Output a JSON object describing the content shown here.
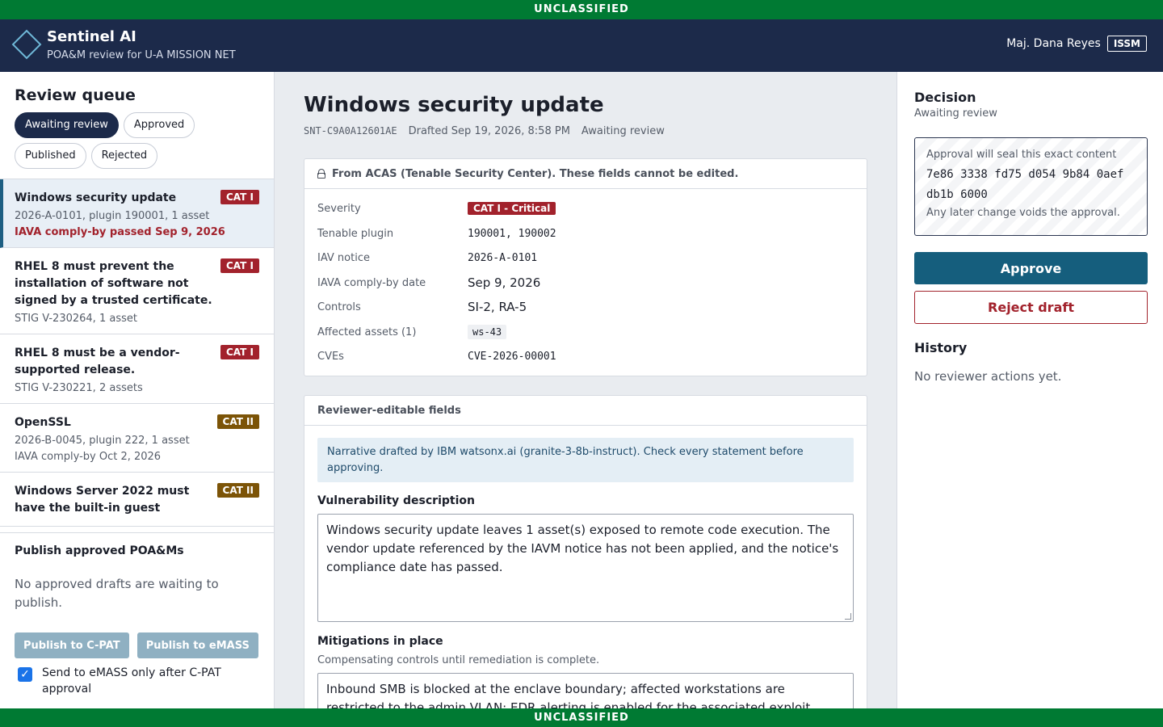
{
  "banner": {
    "top": "UNCLASSIFIED",
    "bottom": "UNCLASSIFIED"
  },
  "app": {
    "name": "Sentinel AI",
    "subtitle": "POA&M review for U-A MISSION NET",
    "logo_icon": "diamond-logo-icon"
  },
  "user": {
    "name": "Maj. Dana Reyes",
    "role": "ISSM"
  },
  "sidebar": {
    "title": "Review queue",
    "filters": [
      {
        "label": "Awaiting review",
        "active": true
      },
      {
        "label": "Approved",
        "active": false
      },
      {
        "label": "Published",
        "active": false
      },
      {
        "label": "Rejected",
        "active": false
      }
    ],
    "items": [
      {
        "title": "Windows security update",
        "meta": "2026-A-0101, plugin 190001, 1 asset",
        "due": "IAVA comply-by passed Sep 9, 2026",
        "overdue": true,
        "cat": "CAT I",
        "selected": true
      },
      {
        "title": "RHEL 8 must prevent the installation of software not signed by a trusted certificate.",
        "meta": "STIG V-230264, 1 asset",
        "due": "",
        "cat": "CAT I"
      },
      {
        "title": "RHEL 8 must be a vendor-supported release.",
        "meta": "STIG V-230221, 2 assets",
        "due": "",
        "cat": "CAT I"
      },
      {
        "title": "OpenSSL",
        "meta": "2026-B-0045, plugin 222, 1 asset",
        "due": "IAVA comply-by Oct 2, 2026",
        "cat": "CAT II"
      },
      {
        "title": "Windows Server 2022 must have the built-in guest",
        "meta": "",
        "due": "",
        "cat": "CAT II"
      }
    ],
    "publish": {
      "title": "Publish approved POA&Ms",
      "empty": "No approved drafts are waiting to publish.",
      "cpat_button": "Publish to C-PAT",
      "emass_button": "Publish to eMASS",
      "checkbox_label": "Send to eMASS only after C-PAT approval",
      "checkbox_checked": true
    }
  },
  "main": {
    "title": "Windows security update",
    "id": "SNT-C9A0A12601AE",
    "drafted": "Drafted Sep 19, 2026, 8:58 PM",
    "status": "Awaiting review",
    "source": {
      "header": "From ACAS (Tenable Security Center). These fields cannot be edited.",
      "fields": {
        "severity_label": "Severity",
        "severity": "CAT I - Critical",
        "plugin_label": "Tenable plugin",
        "plugin": "190001, 190002",
        "iav_label": "IAV notice",
        "iav": "2026-A-0101",
        "comply_label": "IAVA comply-by date",
        "comply": "Sep 9, 2026",
        "controls_label": "Controls",
        "controls": "SI-2, RA-5",
        "assets_label": "Affected assets (1)",
        "assets": "ws-43",
        "cves_label": "CVEs",
        "cves": "CVE-2026-00001"
      }
    },
    "editable": {
      "header": "Reviewer-editable fields",
      "notice": "Narrative drafted by IBM watsonx.ai (granite-3-8b-instruct). Check every statement before approving.",
      "desc_label": "Vulnerability description",
      "desc_value": "Windows security update leaves 1 asset(s) exposed to remote code execution. The vendor update referenced by the IAVM notice has not been applied, and the notice's compliance date has passed.",
      "mit_label": "Mitigations in place",
      "mit_help": "Compensating controls until remediation is complete.",
      "mit_value": "Inbound SMB is blocked at the enclave boundary; affected workstations are restricted to the admin VLAN; EDR alerting is enabled for the associated exploit."
    }
  },
  "decision": {
    "title": "Decision",
    "status": "Awaiting review",
    "seal_intro": "Approval will seal this exact content",
    "seal_hash": "7e86 3338 fd75 d054 9b84 0aef db1b 6000",
    "seal_note": "Any later change voids the approval.",
    "approve_label": "Approve",
    "reject_label": "Reject draft",
    "history_title": "History",
    "history_empty": "No reviewer actions yet."
  },
  "colors": {
    "banner": "#007a33",
    "header": "#1c2a4a",
    "cat_i": "#a2222c",
    "cat_ii": "#7c5407",
    "approve": "#155e7d"
  }
}
